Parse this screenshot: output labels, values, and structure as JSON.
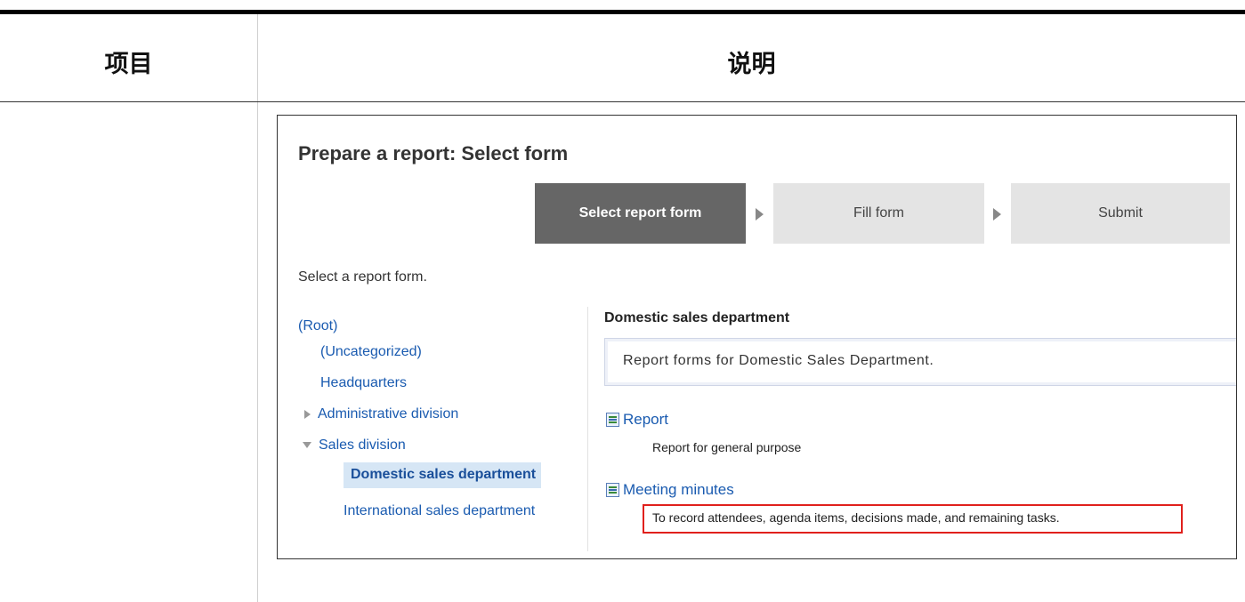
{
  "table": {
    "col1_header": "项目",
    "col2_header": "说明"
  },
  "screen": {
    "title": "Prepare a report: Select form",
    "steps": [
      {
        "label": "Select report form"
      },
      {
        "label": "Fill form"
      },
      {
        "label": "Submit"
      }
    ],
    "instruction": "Select a report form.",
    "tree": [
      {
        "label": "(Root)"
      },
      {
        "label": "(Uncategorized)"
      },
      {
        "label": "Headquarters"
      },
      {
        "label": "Administrative division"
      },
      {
        "label": "Sales division"
      },
      {
        "label": "Domestic sales department"
      },
      {
        "label": "International sales department"
      }
    ],
    "category": {
      "title": "Domestic sales department",
      "description": "Report forms for Domestic Sales Department."
    },
    "forms": [
      {
        "name": "Report",
        "description": "Report for general purpose"
      },
      {
        "name": "Meeting minutes",
        "description": "To record attendees, agenda items, decisions made, and remaining tasks."
      }
    ]
  }
}
